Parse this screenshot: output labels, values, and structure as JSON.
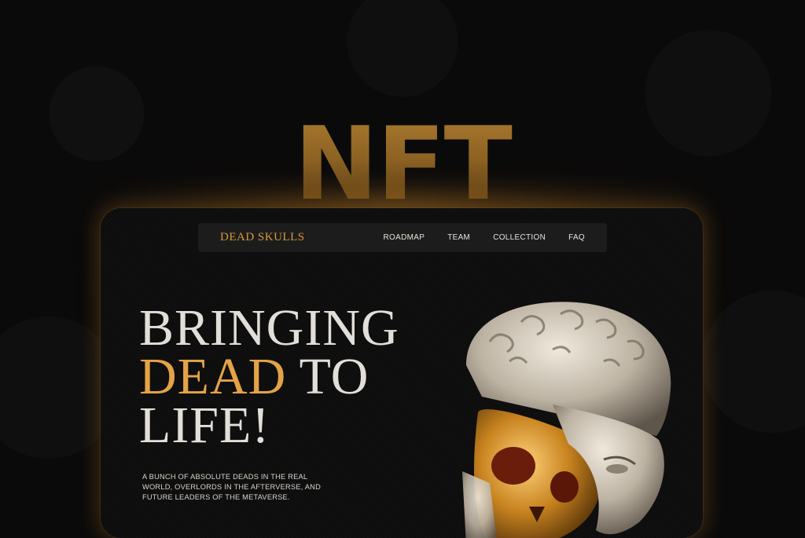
{
  "hero_word": "NFT",
  "navbar": {
    "brand": "DEAD SKULLS",
    "links": [
      "ROADMAP",
      "TEAM",
      "COLLECTION",
      "FAQ"
    ]
  },
  "hero": {
    "line1": "BRINGING",
    "line2_accent": "DEAD",
    "line2_rest": " TO",
    "line3": "LIFE!",
    "tagline": "A BUNCH OF ABSOLUTE DEADS IN THE REAL WORLD, OVERLORDS IN THE AFTERVERSE, AND FUTURE LEADERS OF THE METAVERSE."
  },
  "colors": {
    "accent": "#e3a346",
    "brand": "#d59a3e",
    "background": "#0b0a0a",
    "text": "#e2ded8"
  },
  "icons": {
    "statue": "split-marble-head-golden-skull"
  }
}
